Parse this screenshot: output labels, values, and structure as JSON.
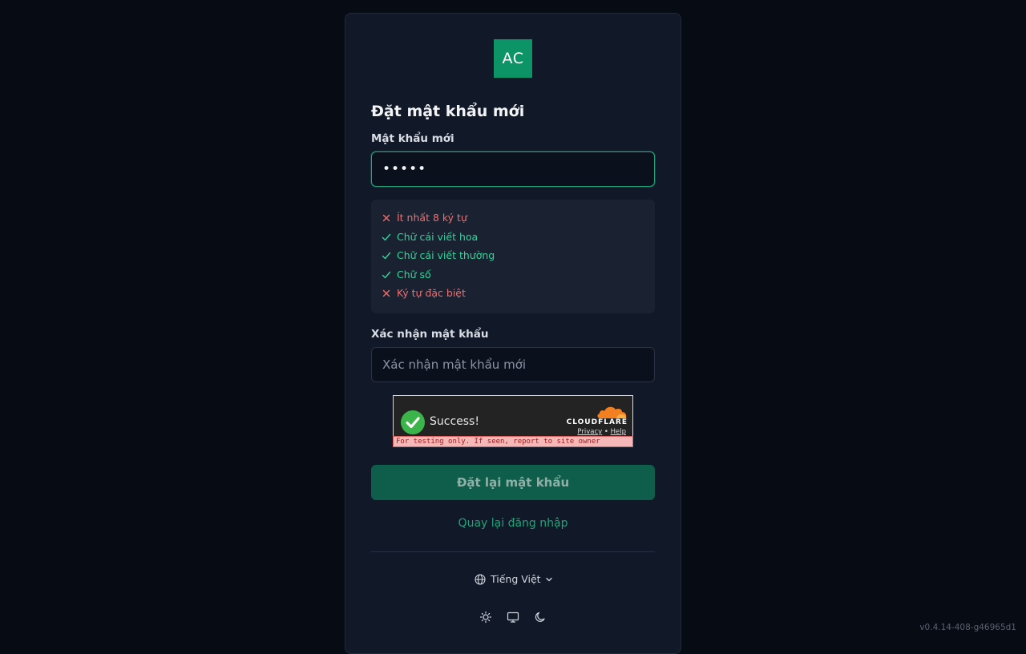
{
  "brand": {
    "logo_text": "AC",
    "accent": "#0d9466"
  },
  "form": {
    "title": "Đặt mật khẩu mới",
    "new_password_label": "Mật khẩu mới",
    "new_password_value": "•••••",
    "requirements": [
      {
        "text": "Ít nhất 8 ký tự",
        "status": "fail"
      },
      {
        "text": "Chữ cái viết hoa",
        "status": "pass"
      },
      {
        "text": "Chữ cái viết thường",
        "status": "pass"
      },
      {
        "text": "Chữ số",
        "status": "pass"
      },
      {
        "text": "Ký tự đặc biệt",
        "status": "fail"
      }
    ],
    "confirm_label": "Xác nhận mật khẩu",
    "confirm_placeholder": "Xác nhận mật khẩu mới",
    "submit_label": "Đặt lại mật khẩu",
    "back_link": "Quay lại đăng nhập"
  },
  "captcha": {
    "status_text": "Success!",
    "provider": "CLOUDFLARE",
    "privacy_link": "Privacy",
    "separator": "•",
    "help_link": "Help",
    "warning": "For testing only. If seen, report to site owner"
  },
  "footer": {
    "language": "Tiếng Việt",
    "theme_options": [
      "light-theme",
      "system-theme",
      "dark-theme"
    ]
  },
  "version": "v0.4.14-408-g46965d1",
  "colors": {
    "fail": "#f26d6d",
    "pass": "#34d399",
    "link": "#22a47a",
    "submit_bg": "#0e5e4b"
  }
}
